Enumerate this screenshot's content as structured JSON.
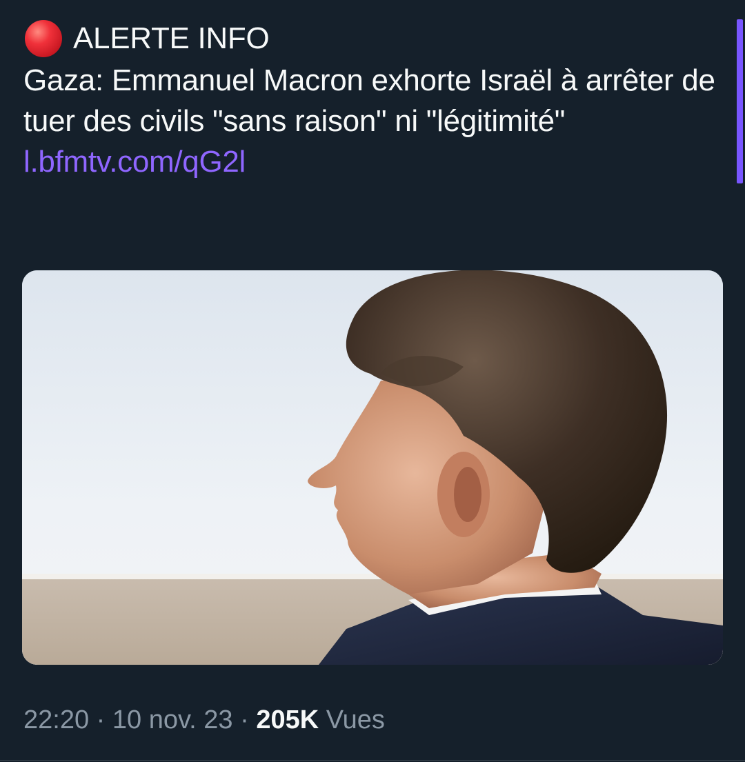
{
  "tweet": {
    "alert_label": "ALERTE INFO",
    "headline": "Gaza: Emmanuel Macron exhorte Israël à arrêter de tuer des civils \"sans raison\" ni \"légitimité\"",
    "link_text": "l.bfmtv.com/qG2l",
    "alert_icon": "red-circle-emoji"
  },
  "meta": {
    "time": "22:20",
    "separator": "·",
    "date": "10 nov. 23",
    "views_count": "205K",
    "views_label": "Vues"
  },
  "colors": {
    "background": "#15202b",
    "link": "#8f66ff",
    "secondary_text": "#8b98a5",
    "scroll_accent": "#7856ff"
  }
}
